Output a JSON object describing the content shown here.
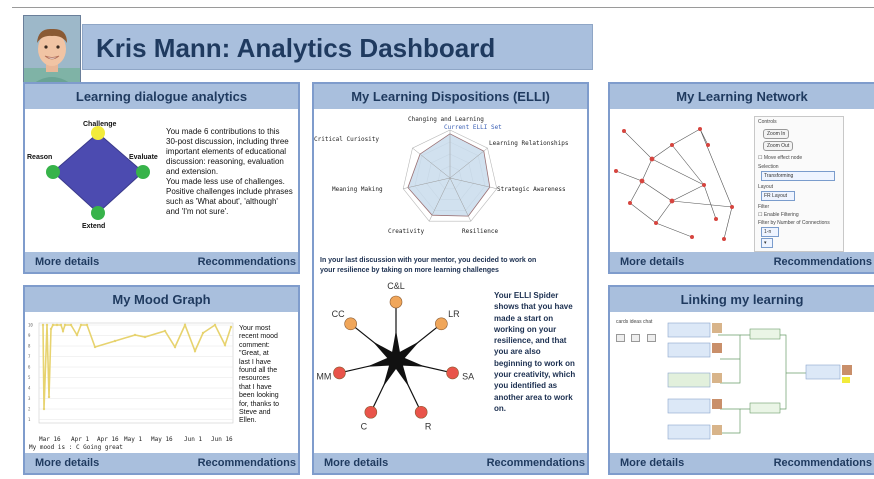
{
  "header": {
    "title": "Kris Mann: Analytics Dashboard"
  },
  "footer": {
    "more_details": "More details",
    "recommendations": "Recommendations"
  },
  "dialogue": {
    "title": "Learning dialogue analytics",
    "labels": {
      "top": "Challenge",
      "left": "Reason",
      "right": "Evaluate",
      "bottom": "Extend"
    },
    "text": [
      "You made 6 contributions to this",
      "30-post discussion, including three",
      "important elements of educational",
      "discussion: reasoning, evaluation",
      "and extension.",
      "You made less use of challenges.",
      "Positive challenges include phrases",
      "such as 'What about', 'although'",
      "and 'I'm not sure'."
    ]
  },
  "mood": {
    "title": "My Mood Graph",
    "y_ticks": [
      "10",
      "9",
      "8",
      "7",
      "6",
      "5",
      "4",
      "3",
      "2",
      "1"
    ],
    "x_ticks": [
      "Mar 16",
      "Apr 1",
      "Apr 16",
      "May 1",
      "May 16",
      "Jun 1",
      "Jun 16"
    ],
    "caption": "My mood is : C Going great",
    "comment": [
      "Your most",
      "recent mood",
      "comment:",
      "\"Great, at",
      "last I have",
      "found all the",
      "resources",
      "that I have",
      "been looking",
      "for, thanks to",
      "Steve and",
      "Ellen."
    ],
    "line_color": "#e7d36f"
  },
  "elli": {
    "title": "My Learning Dispositions (ELLI)",
    "axes": [
      "Changing and Learning",
      "Learning Relationships",
      "Strategic Awareness",
      "Resilience",
      "Creativity",
      "Meaning Making",
      "Critical Curiosity"
    ],
    "note": "Current ELLI Set",
    "message_lines": [
      "In your last discussion with your mentor, you decided to work on",
      "your resilience by taking on more learning challenges"
    ],
    "spider_labels": [
      "C&L",
      "LR",
      "SA",
      "R",
      "C",
      "MM",
      "CC"
    ],
    "spider_colors": [
      "#f0a65a",
      "#f0a65a",
      "#e9544a",
      "#e9544a",
      "#e9544a",
      "#e9544a",
      "#f0a65a"
    ],
    "side_text": [
      "Your ELLI Spider",
      "shows that you have",
      "made a start on",
      "working on your",
      "resilience, and that",
      "you are also",
      "beginning to work on",
      "your creativity, which",
      "you identified as",
      "another area to work",
      "on."
    ]
  },
  "network": {
    "title": "My Learning Network",
    "controls": {
      "controls_label": "Controls",
      "zoom_in": "Zoom In",
      "zoom_out": "Zoom Out",
      "move_label": "Move effect node",
      "selection_label": "Selection",
      "selection_value": "Transforming",
      "layout_label": "Layout",
      "layout_value": "FR Layout",
      "filter_label": "Filter",
      "enable_filter": "Enable Filtering",
      "filter_num_label": "Filter by Number of Connections",
      "filter_num_value": "1-n"
    }
  },
  "linking": {
    "title": "Linking my learning",
    "toolbar": [
      "cards",
      "ideas",
      "chat"
    ]
  }
}
